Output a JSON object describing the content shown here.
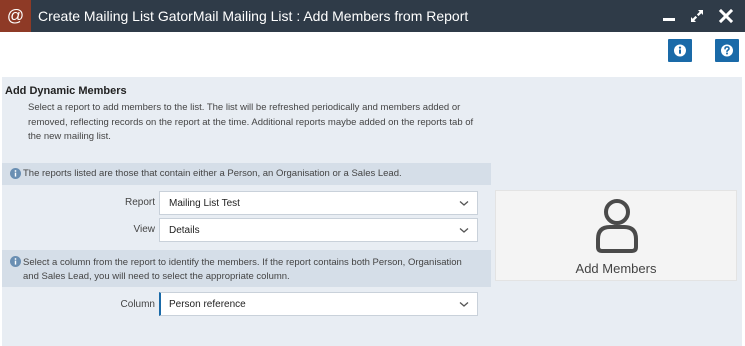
{
  "window": {
    "app_icon_glyph": "@",
    "title": "Create Mailing List GatorMail Mailing List : Add Members from Report",
    "minimize_icon": "minimize-icon",
    "maximize_icon": "maximize-icon",
    "close_icon": "close-icon"
  },
  "toolbar": {
    "info_icon": "info-icon",
    "help_icon": "question-icon"
  },
  "section": {
    "title": "Add Dynamic Members",
    "description": "Select a report to add members to the list. The list will be refreshed periodically and members added or removed, reflecting records on the report at the time. Additional reports maybe added on the reports tab of the new mailing list."
  },
  "notes": {
    "reports_note": "The reports listed are those that contain either a Person, an Organisation or a Sales Lead.",
    "column_note": "Select a column from the report to identify the members. If the report contains both Person, Organisation and Sales Lead, you will need to select the appropriate column."
  },
  "form": {
    "report_label": "Report",
    "report_value": "Mailing List Test",
    "view_label": "View",
    "view_value": "Details",
    "column_label": "Column",
    "column_value": "Person reference"
  },
  "add_members": {
    "label": "Add Members",
    "icon": "person-icon"
  },
  "colors": {
    "titlebar": "#2f3b48",
    "app_icon_bg": "#8e3a26",
    "accent": "#1a6aa8",
    "panel": "#e8edf3",
    "note_bg": "#d5dee8"
  }
}
